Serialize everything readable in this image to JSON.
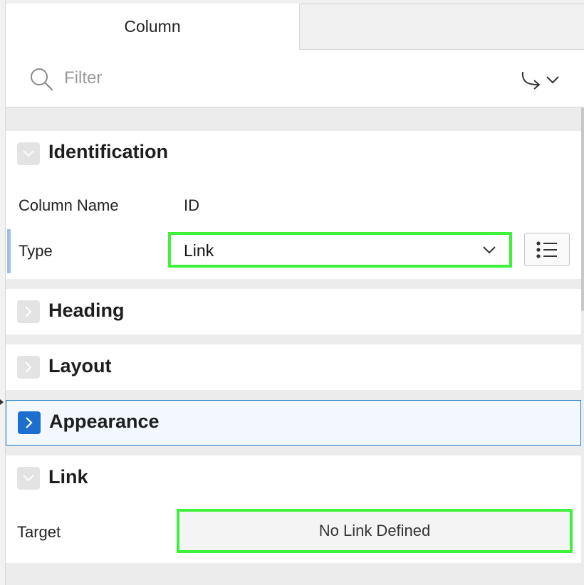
{
  "tabs": [
    {
      "label": "Column"
    }
  ],
  "filter": {
    "placeholder": "Filter"
  },
  "sections": {
    "identification": {
      "title": "Identification",
      "column_name_label": "Column Name",
      "column_name_value": "ID",
      "type_label": "Type",
      "type_value": "Link"
    },
    "heading": {
      "title": "Heading"
    },
    "layout": {
      "title": "Layout"
    },
    "appearance": {
      "title": "Appearance"
    },
    "link": {
      "title": "Link",
      "target_label": "Target",
      "target_value": "No Link Defined"
    }
  },
  "colors": {
    "highlight": "#3ef23b",
    "active_accent": "#1c6fcf",
    "active_background": "#f2f8fd"
  }
}
